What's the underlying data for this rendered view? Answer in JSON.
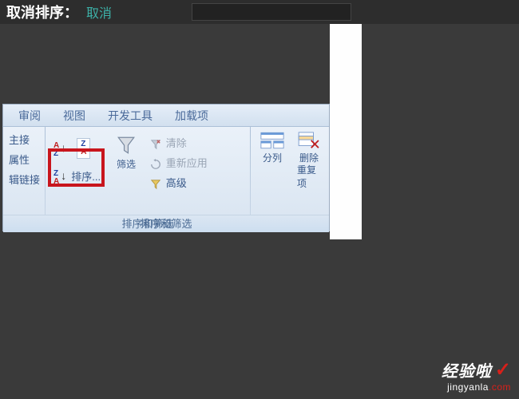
{
  "topbar": {
    "partial_text": "取消排序：",
    "teal_text": "取消"
  },
  "tabs": {
    "t1": "审阅",
    "t2": "视图",
    "t3": "开发工具",
    "t4": "加载项"
  },
  "group1": {
    "item1": "主接",
    "item2": "属性",
    "item3": "辑链接"
  },
  "sort": {
    "az_a": "A",
    "az_z": "Z",
    "za_z": "Z",
    "za_a": "A",
    "label": "排序...",
    "filter_label": "筛选"
  },
  "filter_opts": {
    "clear": "清除",
    "reapply": "重新应用",
    "advanced": "高级"
  },
  "group3": {
    "split": "分列",
    "remove": "删除",
    "dup": "重复项"
  },
  "footer": {
    "label": "排序和筛选"
  },
  "watermark": {
    "brand": "经验啦",
    "url_prefix": "jingyanla",
    "url_suffix": ".com"
  }
}
